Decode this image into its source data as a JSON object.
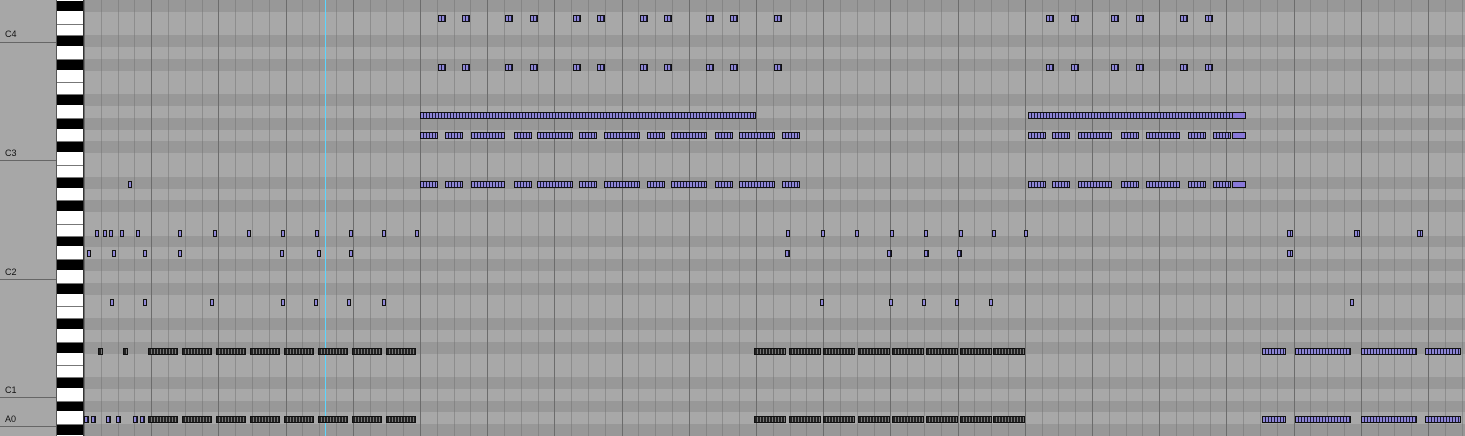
{
  "octave_labels": [
    "C4",
    "C3",
    "C2",
    "C1",
    "A0"
  ],
  "colors": {
    "note_fill": "#8e86d6",
    "note_dark": "#222222",
    "playhead": "#5cd6ff",
    "grid_light": "#a8a8a8",
    "grid_dark": "#989898"
  },
  "icons": {
    "piano": "piano-keyboard-icon",
    "playhead": "playhead-icon"
  }
}
